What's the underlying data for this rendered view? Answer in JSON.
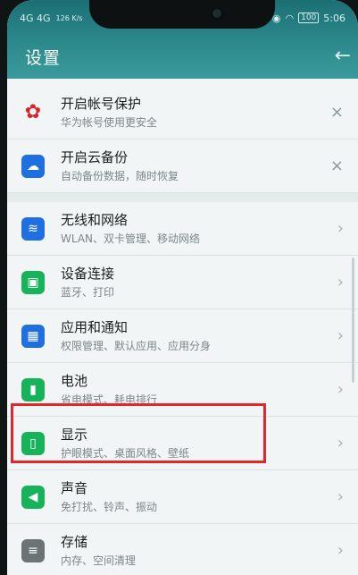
{
  "status": {
    "left_text": "4G 4G",
    "speed": "126 K/s",
    "battery": "100",
    "time": "5:06"
  },
  "header": {
    "title": "设置",
    "back_icon": "arrow-left-icon"
  },
  "items": [
    {
      "title": "开启帐号保护",
      "subtitle": "华为帐号使用更安全",
      "icon": "huawei-logo-icon",
      "color": "#d8232a",
      "trail": "×"
    },
    {
      "title": "开启云备份",
      "subtitle": "自动备份数据，随时恢复",
      "icon": "cloud-icon",
      "color": "#1f6fe0",
      "trail": "×"
    },
    {
      "title": "无线和网络",
      "subtitle": "WLAN、双卡管理、移动网络",
      "icon": "wifi-icon",
      "color": "#1f6fe0",
      "trail": "›"
    },
    {
      "title": "设备连接",
      "subtitle": "蓝牙、打印",
      "icon": "device-link-icon",
      "color": "#17b35a",
      "trail": "›"
    },
    {
      "title": "应用和通知",
      "subtitle": "权限管理、默认应用、应用分身",
      "icon": "apps-grid-icon",
      "color": "#1f6fe0",
      "trail": "›"
    },
    {
      "title": "电池",
      "subtitle": "省电模式、耗电排行",
      "icon": "battery-icon",
      "color": "#17b35a",
      "trail": "›"
    },
    {
      "title": "显示",
      "subtitle": "护眼模式、桌面风格、壁纸",
      "icon": "display-icon",
      "color": "#17b35a",
      "trail": "›"
    },
    {
      "title": "声音",
      "subtitle": "免打扰、铃声、振动",
      "icon": "sound-icon",
      "color": "#17b35a",
      "trail": "›"
    },
    {
      "title": "存储",
      "subtitle": "内存、空间清理",
      "icon": "storage-icon",
      "color": "#6b7375",
      "trail": "›"
    }
  ],
  "highlight_color": "#e2262c"
}
